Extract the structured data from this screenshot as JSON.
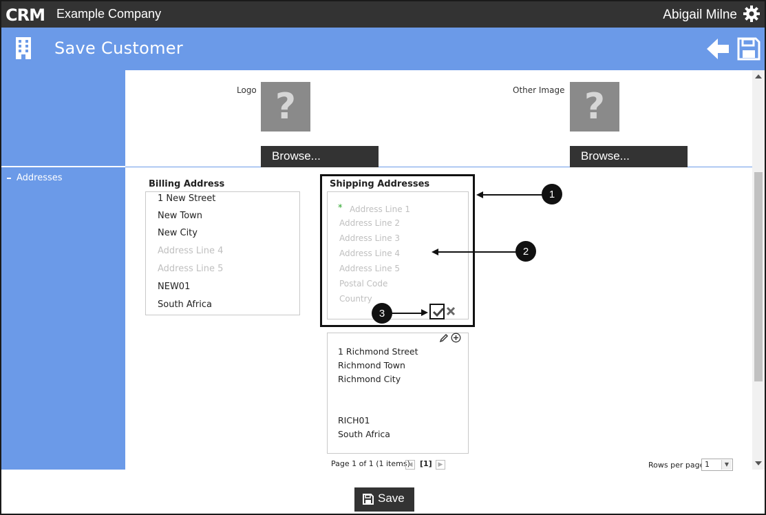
{
  "app": {
    "logo_text": "CRM",
    "company": "Example Company",
    "user": "Abigail Milne"
  },
  "header": {
    "title": "Save Customer"
  },
  "sidebar": {
    "items": [
      {
        "label": "Addresses"
      }
    ]
  },
  "images": {
    "logo": {
      "label": "Logo",
      "placeholder": "?",
      "browse_label": "Browse..."
    },
    "other": {
      "label": "Other Image",
      "placeholder": "?",
      "browse_label": "Browse..."
    }
  },
  "billing": {
    "title": "Billing Address",
    "lines": [
      {
        "text": "1 New Street",
        "placeholder": false
      },
      {
        "text": "New Town",
        "placeholder": false
      },
      {
        "text": "New City",
        "placeholder": false
      },
      {
        "text": "Address Line 4",
        "placeholder": true
      },
      {
        "text": "Address Line 5",
        "placeholder": true
      },
      {
        "text": "NEW01",
        "placeholder": false
      },
      {
        "text": "South Africa",
        "placeholder": false
      }
    ]
  },
  "shipping": {
    "title": "Shipping Addresses",
    "required_mark": "*",
    "form_placeholders": [
      "Address Line 1",
      "Address Line 2",
      "Address Line 3",
      "Address Line 4",
      "Address Line 5",
      "Postal Code",
      "Country"
    ],
    "saved": {
      "lines": [
        "1 Richmond Street",
        "Richmond Town",
        "Richmond City",
        "",
        "",
        "RICH01",
        "South Africa"
      ]
    }
  },
  "callouts": [
    "1",
    "2",
    "3"
  ],
  "pager": {
    "summary": "Page 1 of 1 (1 items)",
    "current": "[1]",
    "rows_label": "Rows per page:",
    "rows_value": "1"
  },
  "footer": {
    "save_label": "Save"
  },
  "colors": {
    "topbar": "#333333",
    "accent": "#6b9ae8",
    "button": "#333333",
    "required": "#2aa52a"
  }
}
